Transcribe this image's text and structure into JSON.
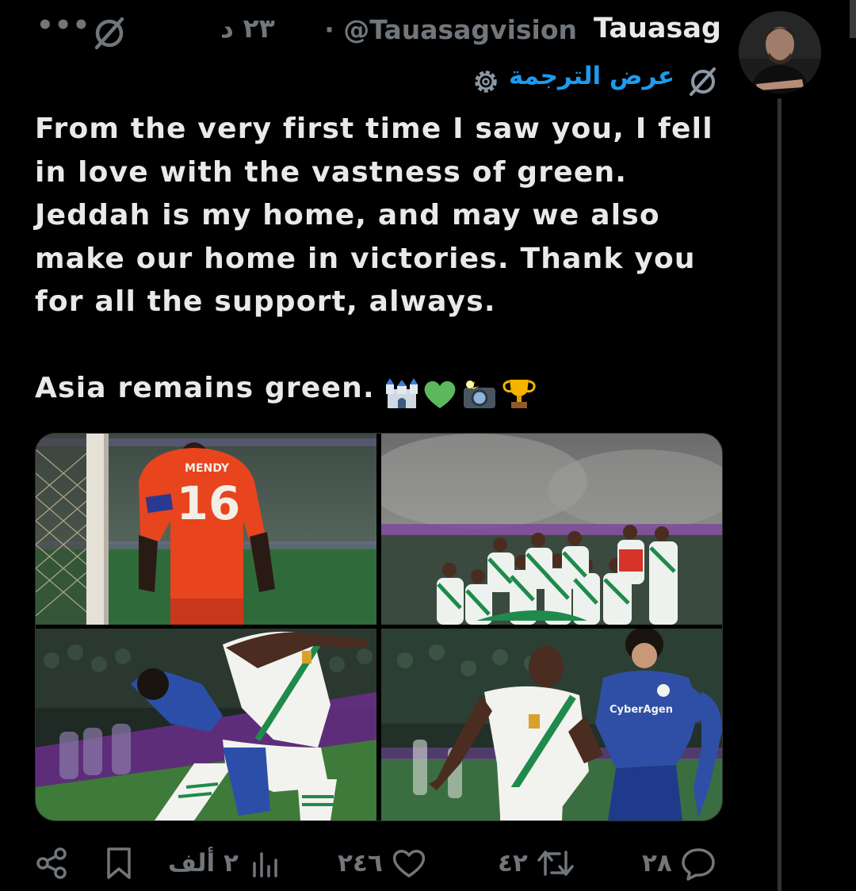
{
  "header": {
    "display_name": "Tauasag",
    "handle": "@Tauasagvision",
    "separator": "·",
    "time": "٢٣ د",
    "more_icon": "more-horizontal-icon",
    "grok_icon": "grok-icon"
  },
  "translate": {
    "label": "عرض الترجمة",
    "icon_gear": "gear-icon",
    "icon_grok": "grok-icon"
  },
  "tweet": {
    "paragraph1": "From the very first time I saw you, I fell\nin love with the vastness of green.\nJeddah is my home, and may we also\nmake our home in victories. Thank you\nfor all the support, always.",
    "paragraph2": "Asia remains green.",
    "emojis": [
      "castle",
      "green-heart",
      "camera-with-flash",
      "trophy"
    ]
  },
  "media": {
    "photo1_jersey_name": "MENDY",
    "photo1_jersey_number": "16",
    "photo4_sponsor": "CyberAgen"
  },
  "actions": {
    "replies": "٢٨",
    "reposts": "٤٢",
    "likes": "٢٤٦",
    "views": "٢ ألف",
    "bookmark_icon": "bookmark-icon",
    "share_icon": "share-icon"
  },
  "colors": {
    "background": "#000000",
    "text": "#e7e9ea",
    "secondary": "#71767b",
    "link": "#1d9bf0",
    "team_green": "#1f8a4c"
  }
}
